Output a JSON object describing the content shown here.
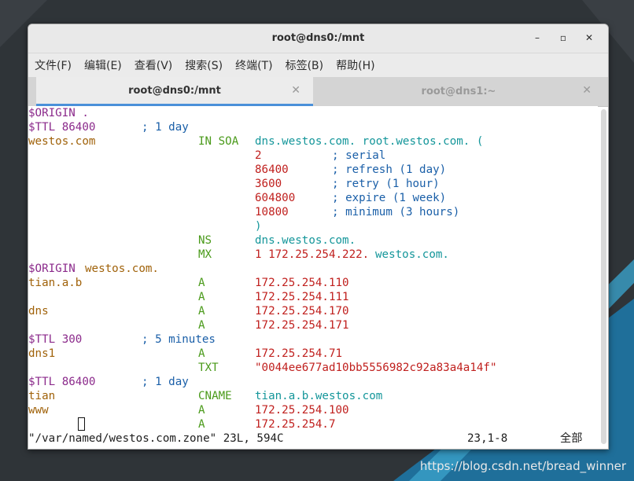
{
  "window": {
    "title": "root@dns0:/mnt",
    "minimize": "–",
    "maximize": "▫",
    "close": "✕"
  },
  "menu": [
    "文件(F)",
    "编辑(E)",
    "查看(V)",
    "搜索(S)",
    "终端(T)",
    "标签(B)",
    "帮助(H)"
  ],
  "tabs": [
    {
      "label": "root@dns0:/mnt",
      "active": true
    },
    {
      "label": "root@dns1:~",
      "active": false
    }
  ],
  "terminal_lines": [
    [
      [
        "$ORIGIN .",
        "purple",
        0
      ]
    ],
    [
      [
        "$TTL 86400",
        "purple",
        0
      ],
      [
        "; 1 day",
        "blue",
        144
      ]
    ],
    [
      [
        "westos.com",
        "brown",
        0
      ],
      [
        "IN SOA",
        "green",
        216
      ],
      [
        "dns.westos.com. root.westos.com. (",
        "teal",
        288
      ]
    ],
    [
      [
        "2",
        "red",
        288
      ],
      [
        "; serial",
        "blue",
        386
      ]
    ],
    [
      [
        "86400",
        "red",
        288
      ],
      [
        "; refresh (1 day)",
        "blue",
        386
      ]
    ],
    [
      [
        "3600",
        "red",
        288
      ],
      [
        "; retry (1 hour)",
        "blue",
        386
      ]
    ],
    [
      [
        "604800",
        "red",
        288
      ],
      [
        "; expire (1 week)",
        "blue",
        386
      ]
    ],
    [
      [
        "10800",
        "red",
        288
      ],
      [
        "; minimum (3 hours)",
        "blue",
        386
      ]
    ],
    [
      [
        ")",
        "teal",
        288
      ]
    ],
    [
      [
        "NS",
        "green",
        216
      ],
      [
        "dns.westos.com.",
        "teal",
        288
      ]
    ],
    [
      [
        "MX",
        "green",
        216
      ],
      [
        "1 172.25.254.222.",
        "red",
        288
      ],
      [
        "westos.com.",
        "teal",
        441
      ]
    ],
    [
      [
        "$ORIGIN",
        "purple",
        0
      ],
      [
        "westos.com.",
        "brown",
        72
      ]
    ],
    [
      [
        "tian.a.b",
        "brown",
        0
      ],
      [
        "A",
        "green",
        216
      ],
      [
        "172.25.254.110",
        "red",
        288
      ]
    ],
    [
      [
        "A",
        "green",
        216
      ],
      [
        "172.25.254.111",
        "red",
        288
      ]
    ],
    [
      [
        "dns",
        "brown",
        0
      ],
      [
        "A",
        "green",
        216
      ],
      [
        "172.25.254.170",
        "red",
        288
      ]
    ],
    [
      [
        "A",
        "green",
        216
      ],
      [
        "172.25.254.171",
        "red",
        288
      ]
    ],
    [
      [
        "$TTL 300",
        "purple",
        0
      ],
      [
        "; 5 minutes",
        "blue",
        144
      ]
    ],
    [
      [
        "dns1",
        "brown",
        0
      ],
      [
        "A",
        "green",
        216
      ],
      [
        "172.25.254.71",
        "red",
        288
      ]
    ],
    [
      [
        "TXT",
        "green",
        216
      ],
      [
        "\"0044ee677ad10bb5556982c92a83a4a14f\"",
        "red",
        288
      ]
    ],
    [
      [
        "$TTL 86400",
        "purple",
        0
      ],
      [
        "; 1 day",
        "blue",
        144
      ]
    ],
    [
      [
        "tian",
        "brown",
        0
      ],
      [
        "CNAME",
        "green",
        216
      ],
      [
        "tian.a.b.westos.com",
        "teal",
        288
      ]
    ],
    [
      [
        "www",
        "brown",
        0
      ],
      [
        "A",
        "green",
        216
      ],
      [
        "172.25.254.100",
        "red",
        288
      ]
    ],
    [
      [
        "A",
        "green",
        216
      ],
      [
        "172.25.254.7",
        "red",
        288
      ]
    ]
  ],
  "status": {
    "file_info": "\"/var/named/westos.com.zone\" 23L, 594C",
    "position": "23,1-8",
    "scroll": "全部"
  },
  "watermark": "https://blog.csdn.net/bread_winner"
}
